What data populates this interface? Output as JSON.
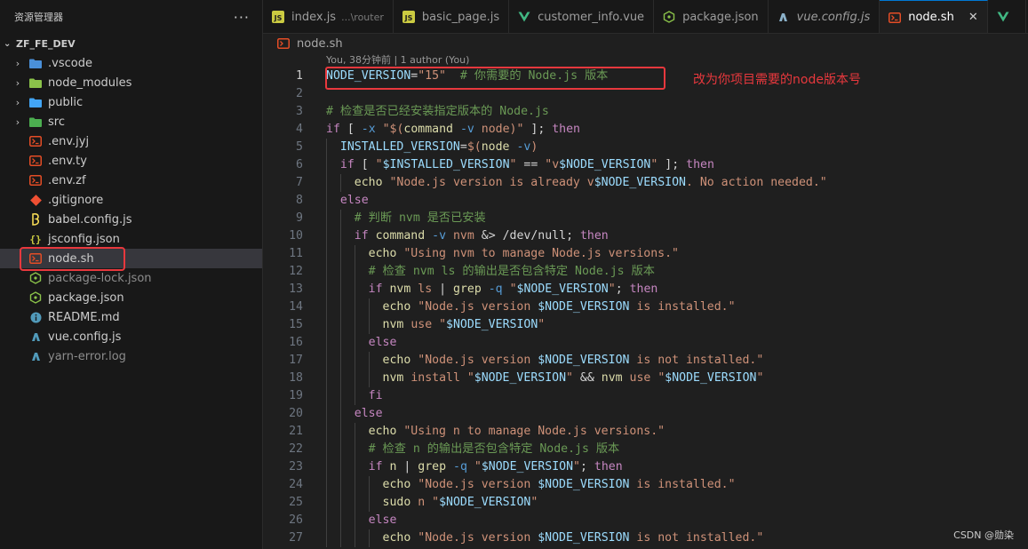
{
  "explorer": {
    "title": "资源管理器",
    "more": "···",
    "root": "ZF_FE_DEV",
    "items": [
      {
        "name": ".vscode",
        "type": "folder",
        "icon": "vscode-folder-icon",
        "color": "#4a90d9",
        "collapsed": true
      },
      {
        "name": "node_modules",
        "type": "folder",
        "icon": "node-modules-folder-icon",
        "color": "#8bc34a",
        "collapsed": true
      },
      {
        "name": "public",
        "type": "folder",
        "icon": "public-folder-icon",
        "color": "#42a5f5",
        "collapsed": true
      },
      {
        "name": "src",
        "type": "folder",
        "icon": "src-folder-icon",
        "color": "#4caf50",
        "collapsed": true
      },
      {
        "name": ".env.jyj",
        "type": "file",
        "icon": "shell-file-icon",
        "color": "#e44d26"
      },
      {
        "name": ".env.ty",
        "type": "file",
        "icon": "shell-file-icon",
        "color": "#e44d26"
      },
      {
        "name": ".env.zf",
        "type": "file",
        "icon": "shell-file-icon",
        "color": "#e44d26"
      },
      {
        "name": ".gitignore",
        "type": "file",
        "icon": "git-file-icon",
        "color": "#f05033"
      },
      {
        "name": "babel.config.js",
        "type": "file",
        "icon": "babel-file-icon",
        "color": "#f5da55"
      },
      {
        "name": "jsconfig.json",
        "type": "file",
        "icon": "json-config-file-icon",
        "color": "#cbcb41"
      },
      {
        "name": "node.sh",
        "type": "file",
        "icon": "shell-file-icon",
        "color": "#e44d26",
        "selected": true
      },
      {
        "name": "package-lock.json",
        "type": "file",
        "icon": "npm-file-icon",
        "color": "#8bc34a",
        "dim": true
      },
      {
        "name": "package.json",
        "type": "file",
        "icon": "npm-file-icon",
        "color": "#8bc34a"
      },
      {
        "name": "README.md",
        "type": "file",
        "icon": "info-file-icon",
        "color": "#519aba"
      },
      {
        "name": "vue.config.js",
        "type": "file",
        "icon": "vue-config-file-icon",
        "color": "#519aba"
      },
      {
        "name": "yarn-error.log",
        "type": "file",
        "icon": "log-file-icon",
        "color": "#519aba",
        "dim": true
      }
    ]
  },
  "tabs": [
    {
      "label": "index.js",
      "sub": "...\\router",
      "icon": "js-file-icon",
      "color": "#cbcb41"
    },
    {
      "label": "basic_page.js",
      "icon": "js-file-icon",
      "color": "#cbcb41"
    },
    {
      "label": "customer_info.vue",
      "icon": "vue-file-icon",
      "color": "#41b883"
    },
    {
      "label": "package.json",
      "icon": "npm-file-icon",
      "color": "#8bc34a"
    },
    {
      "label": "vue.config.js",
      "icon": "vue-config-file-icon",
      "color": "#8bb1c9",
      "italic": true
    },
    {
      "label": "node.sh",
      "icon": "shell-file-icon",
      "color": "#e44d26",
      "active": true,
      "close": "✕"
    },
    {
      "label": "",
      "icon": "vue-file-icon",
      "color": "#41b883"
    }
  ],
  "breadcrumb": {
    "file": "node.sh"
  },
  "editor": {
    "codelens": "You, 38分钟前 | 1 author (You)",
    "line_numbers": [
      "1",
      "2",
      "3",
      "4",
      "5",
      "6",
      "7",
      "8",
      "9",
      "10",
      "11",
      "12",
      "13",
      "14",
      "15",
      "16",
      "17",
      "18",
      "19",
      "20",
      "21",
      "22",
      "23",
      "24",
      "25",
      "26",
      "27"
    ]
  },
  "annotation": {
    "text": "改为你项目需要的node版本号",
    "color": "#e8383d"
  },
  "watermark": "CSDN @勋染",
  "colors": {
    "keyword": "#569cd6",
    "comment": "#6a9955",
    "string": "#ce9178",
    "variable": "#9cdcfe",
    "function": "#dcdcaa"
  }
}
